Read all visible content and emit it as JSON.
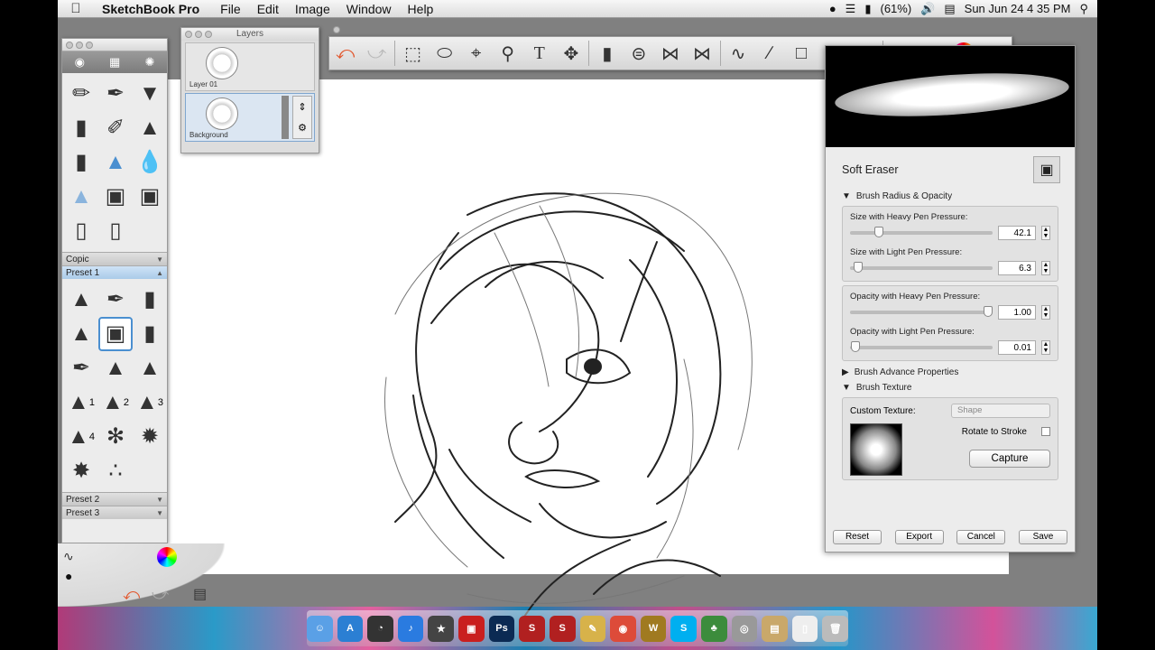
{
  "menubar": {
    "app_name": "SketchBook Pro",
    "menus": [
      "File",
      "Edit",
      "Image",
      "Window",
      "Help"
    ],
    "battery": "(61%)",
    "clock": "Sun Jun 24  4 35 PM"
  },
  "layers_panel": {
    "title": "Layers",
    "layers": [
      {
        "name": "Layer 01",
        "active": false
      },
      {
        "name": "Background",
        "active": true
      }
    ]
  },
  "toolbox": {
    "tabs": [
      "◉",
      "▦",
      "✺"
    ],
    "sets": [
      {
        "label": "Copic",
        "selected": false
      },
      {
        "label": "Preset 1",
        "selected": true
      },
      {
        "label": "Preset 2",
        "selected": false
      },
      {
        "label": "Preset 3",
        "selected": false
      }
    ],
    "preset_numbers": [
      "1",
      "2",
      "3",
      "4"
    ]
  },
  "brush_panel": {
    "brush_name": "Soft Eraser",
    "section_radius_opacity": "Brush Radius & Opacity",
    "size_heavy_label": "Size with Heavy Pen Pressure:",
    "size_heavy_value": "42.1",
    "size_heavy_fraction": 0.18,
    "size_light_label": "Size with Light Pen Pressure:",
    "size_light_value": "6.3",
    "size_light_fraction": 0.03,
    "opacity_heavy_label": "Opacity with Heavy Pen Pressure:",
    "opacity_heavy_value": "1.00",
    "opacity_heavy_fraction": 1.0,
    "opacity_light_label": "Opacity with Light Pen Pressure:",
    "opacity_light_value": "0.01",
    "opacity_light_fraction": 0.01,
    "section_advanced": "Brush Advance Properties",
    "section_texture": "Brush Texture",
    "custom_texture_label": "Custom Texture:",
    "custom_texture_value": "Shape",
    "rotate_label": "Rotate to Stroke",
    "capture_label": "Capture",
    "buttons": {
      "reset": "Reset",
      "export": "Export",
      "cancel": "Cancel",
      "save": "Save"
    }
  },
  "dock": {
    "icons": [
      {
        "name": "finder-icon",
        "color": "#5aa0e6",
        "glyph": "☺"
      },
      {
        "name": "app-store-icon",
        "color": "#2b7fd3",
        "glyph": "A"
      },
      {
        "name": "dashboard-icon",
        "color": "#333333",
        "glyph": "◔"
      },
      {
        "name": "itunes-icon",
        "color": "#2a7be0",
        "glyph": "♪"
      },
      {
        "name": "star-app-icon",
        "color": "#444444",
        "glyph": "★"
      },
      {
        "name": "photo-booth-icon",
        "color": "#c91f1f",
        "glyph": "▣"
      },
      {
        "name": "photoshop-icon",
        "color": "#0b2a53",
        "glyph": "Ps"
      },
      {
        "name": "sketchbook-icon",
        "color": "#b12020",
        "glyph": "S"
      },
      {
        "name": "sketchbook-pro-icon",
        "color": "#b12020",
        "glyph": "S"
      },
      {
        "name": "stickies-icon",
        "color": "#d7b24a",
        "glyph": "✎"
      },
      {
        "name": "chrome-icon",
        "color": "#dd4b39",
        "glyph": "◉"
      },
      {
        "name": "warcraft-icon",
        "color": "#a07a20",
        "glyph": "W"
      },
      {
        "name": "skype-icon",
        "color": "#00aff0",
        "glyph": "S"
      },
      {
        "name": "tree-app-icon",
        "color": "#3c8c3c",
        "glyph": "♣"
      },
      {
        "name": "target-app-icon",
        "color": "#999999",
        "glyph": "◎"
      },
      {
        "name": "folder-icon",
        "color": "#c9a86a",
        "glyph": "▤"
      },
      {
        "name": "document-icon",
        "color": "#eeeeee",
        "glyph": "▯"
      },
      {
        "name": "trash-icon",
        "color": "#bbbbbb",
        "glyph": "🗑"
      }
    ]
  }
}
